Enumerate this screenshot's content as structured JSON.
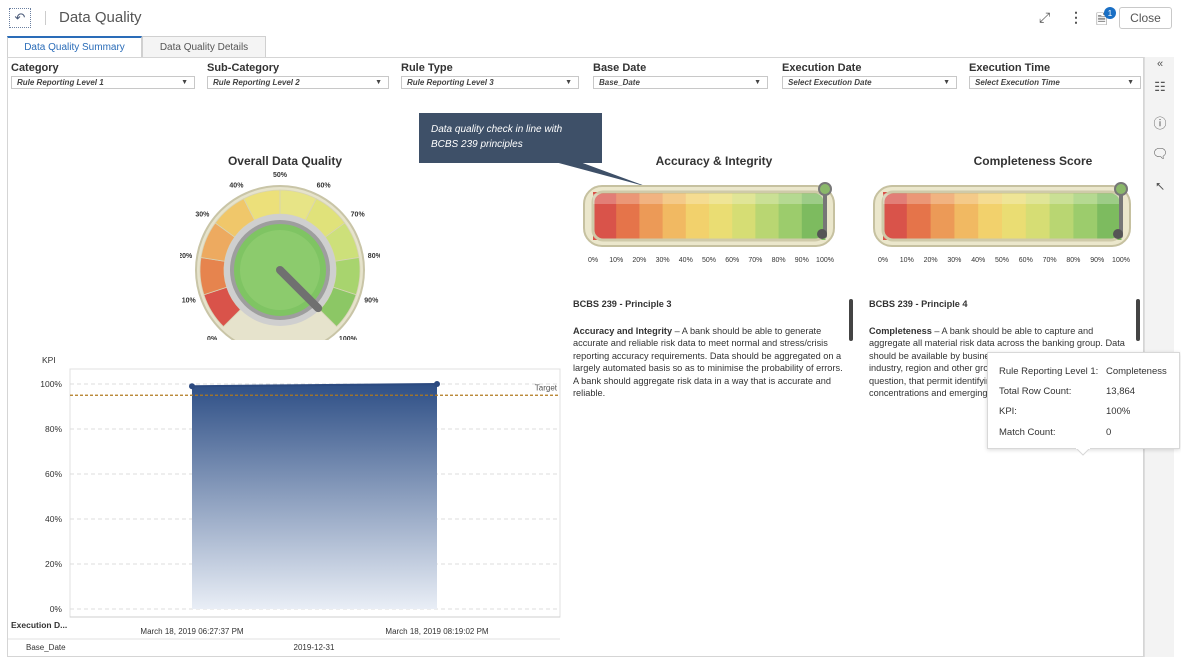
{
  "header": {
    "back_icon": "back-arrow-icon",
    "title": "Data Quality",
    "close_label": "Close",
    "notification_count": "1"
  },
  "tabs": [
    {
      "label": "Data Quality Summary"
    },
    {
      "label": "Data Quality Details"
    }
  ],
  "filters": [
    {
      "label": "Category",
      "value": "Rule Reporting Level 1"
    },
    {
      "label": "Sub-Category",
      "value": "Rule Reporting Level 2"
    },
    {
      "label": "Rule Type",
      "value": "Rule Reporting Level 3"
    },
    {
      "label": "Base Date",
      "value": "Base_Date"
    },
    {
      "label": "Execution Date",
      "value": "Select Execution Date"
    },
    {
      "label": "Execution Time",
      "value": "Select Execution Time"
    }
  ],
  "gauge": {
    "title": "Overall Data Quality",
    "ticks": [
      "0%",
      "10%",
      "20%",
      "30%",
      "40%",
      "50%",
      "60%",
      "70%",
      "80%",
      "90%",
      "100%"
    ],
    "value": 100
  },
  "callout": {
    "text": "Data quality check in line with BCBS 239 principles"
  },
  "bullets": [
    {
      "title": "Accuracy & Integrity",
      "ticks": [
        "0%",
        "10%",
        "20%",
        "30%",
        "40%",
        "50%",
        "60%",
        "70%",
        "80%",
        "90%",
        "100%"
      ],
      "value": 100
    },
    {
      "title": "Completeness Score",
      "ticks": [
        "0%",
        "10%",
        "20%",
        "30%",
        "40%",
        "50%",
        "60%",
        "70%",
        "80%",
        "90%",
        "100%"
      ],
      "value": 100
    }
  ],
  "principles": [
    {
      "heading": "BCBS 239 - Principle 3",
      "term": "Accuracy and Integrity",
      "body": " – A bank should be able to generate accurate and reliable risk data to meet normal and stress/crisis reporting accuracy requirements. Data should be aggregated on a largely automated basis so as to minimise the probability of errors. A bank should aggregate risk data in a way that is accurate and reliable."
    },
    {
      "heading": "BCBS 239 - Principle 4",
      "term": "Completeness",
      "body": " – A bank should be able to capture and aggregate all material risk data across the banking group. Data should be available by business line, legal entity, asset type, industry, region and other groupings, as relevant for the risk in question, that permit identifying and reporting risk exposures, concentrations and emerging risks."
    }
  ],
  "tooltip": [
    {
      "k": "Rule Reporting Level 1:",
      "v": "Completeness"
    },
    {
      "k": "Total Row Count:",
      "v": "13,864"
    },
    {
      "k": "KPI:",
      "v": "100%"
    },
    {
      "k": "Match Count:",
      "v": "0"
    }
  ],
  "treemap": [
    {
      "label": "Accuracy & Integrity",
      "color": "#1a2e4e"
    },
    {
      "label": "Completeness",
      "color": "#10233a"
    }
  ],
  "chart_data": {
    "type": "area",
    "ylabel": "KPI",
    "ylim": [
      0,
      100
    ],
    "yticks": [
      "0%",
      "20%",
      "40%",
      "60%",
      "80%",
      "100%"
    ],
    "x": [
      "March 18, 2019 06:27:37 PM",
      "March 18, 2019 08:19:02 PM"
    ],
    "values": [
      99,
      100
    ],
    "target": {
      "label": "Target",
      "value": 95
    },
    "x_axis_title": "Execution D...",
    "base_axis_title": "Base_Date",
    "base_value": "2019-12-31",
    "colors": {
      "line": "#2c4a80",
      "target": "#b07a1f"
    }
  }
}
